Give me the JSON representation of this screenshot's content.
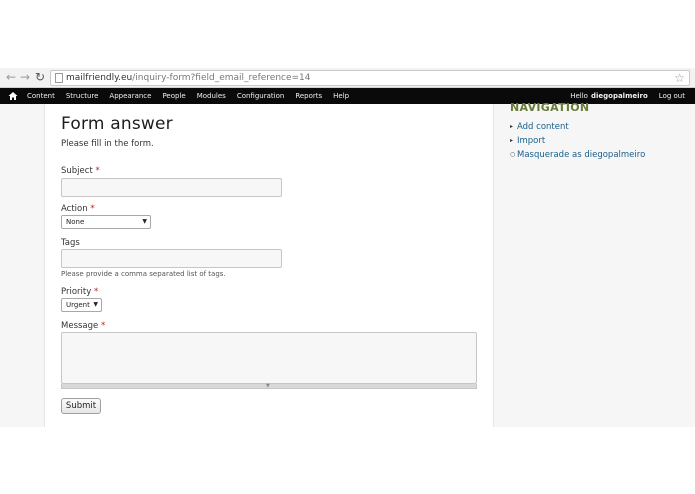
{
  "browser": {
    "url_host": "mailfriendly.eu",
    "url_path": "/inquiry-form?field_email_reference=14"
  },
  "toolbar": {
    "menu": [
      "Content",
      "Structure",
      "Appearance",
      "People",
      "Modules",
      "Configuration",
      "Reports",
      "Help"
    ],
    "greeting": "Hello",
    "username": "diegopalmeiro",
    "logout": "Log out"
  },
  "form": {
    "title": "Form answer",
    "intro": "Please fill in the form.",
    "required_marker": "*",
    "subject_label": "Subject",
    "action_label": "Action",
    "action_value": "None",
    "tags_label": "Tags",
    "tags_description": "Please provide a comma separated list of tags.",
    "priority_label": "Priority",
    "priority_value": "Urgent",
    "message_label": "Message",
    "submit_label": "Submit"
  },
  "sidebar": {
    "title": "NAVIGATION",
    "items": [
      "Add content",
      "Import",
      "Masquerade as diegopalmeiro"
    ]
  }
}
